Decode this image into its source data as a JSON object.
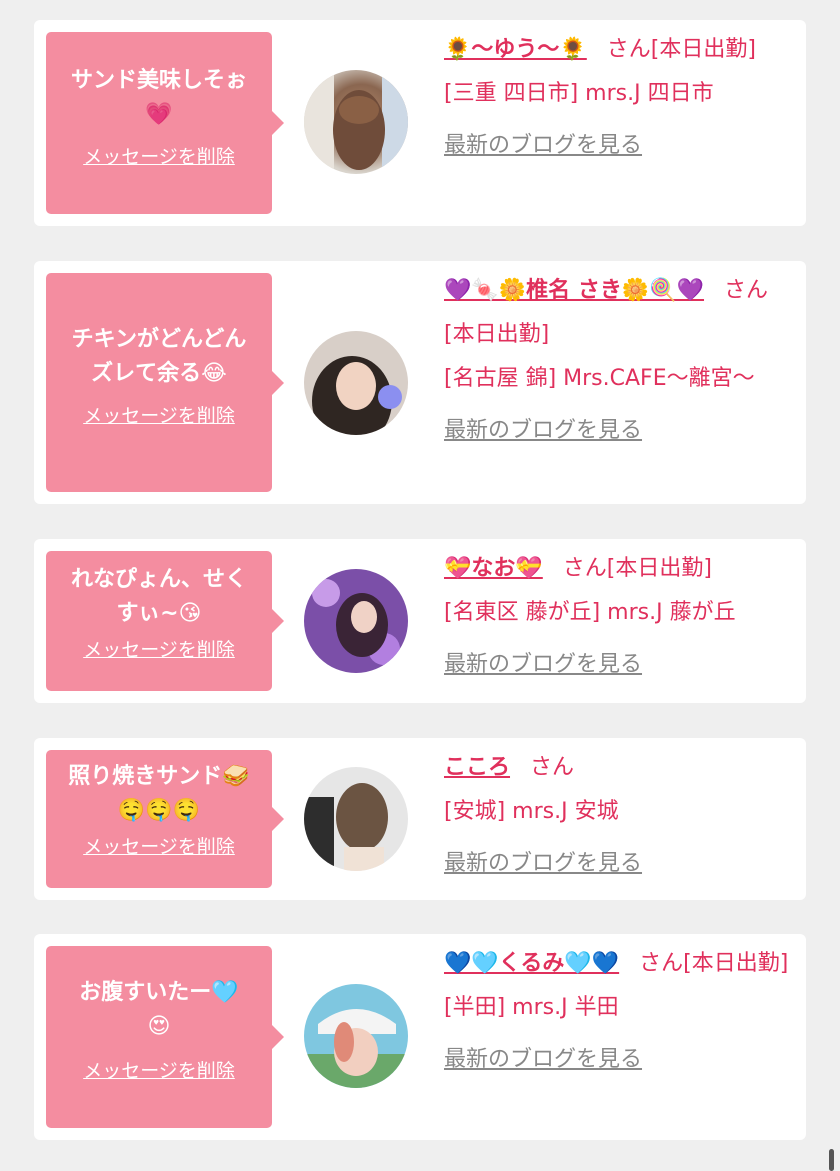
{
  "entries": [
    {
      "message": "サンド美味しそぉ\n💗",
      "delete_label": "メッセージを削除",
      "name": "🌻〜ゆう〜🌻",
      "suffix": "さん[本日出勤]",
      "area": "[三重 四日市] mrs.J 四日市",
      "blog_label": "最新のブログを見る"
    },
    {
      "message": "チキンがどんどん\nズレて余る😂",
      "delete_label": "メッセージを削除",
      "name": "💜🍬🌼椎名 さき🌼🍭💜",
      "suffix": "さん[本日出勤]",
      "area": "[名古屋 錦] Mrs.CAFE〜離宮〜",
      "blog_label": "最新のブログを見る"
    },
    {
      "message": "れなぴょん、せく\nすぃ~😘",
      "delete_label": "メッセージを削除",
      "name": "💝なお💝",
      "suffix": "さん[本日出勤]",
      "area": "[名東区 藤が丘] mrs.J 藤が丘",
      "blog_label": "最新のブログを見る"
    },
    {
      "message": "照り焼きサンド🥪\n🤤🤤🤤",
      "delete_label": "メッセージを削除",
      "name": "こころ",
      "suffix": "さん",
      "area": "[安城] mrs.J 安城",
      "blog_label": "最新のブログを見る"
    },
    {
      "message": "お腹すいたー🩵\n😍",
      "delete_label": "メッセージを削除",
      "name": "💙🩵くるみ🩵💙",
      "suffix": "さん[本日出勤]",
      "area": "[半田] mrs.J 半田",
      "blog_label": "最新のブログを見る"
    }
  ],
  "colors": {
    "page_bg": "#efefef",
    "bubble": "#f48da0",
    "accent_text": "#e0305c",
    "link_gray": "#888888"
  }
}
